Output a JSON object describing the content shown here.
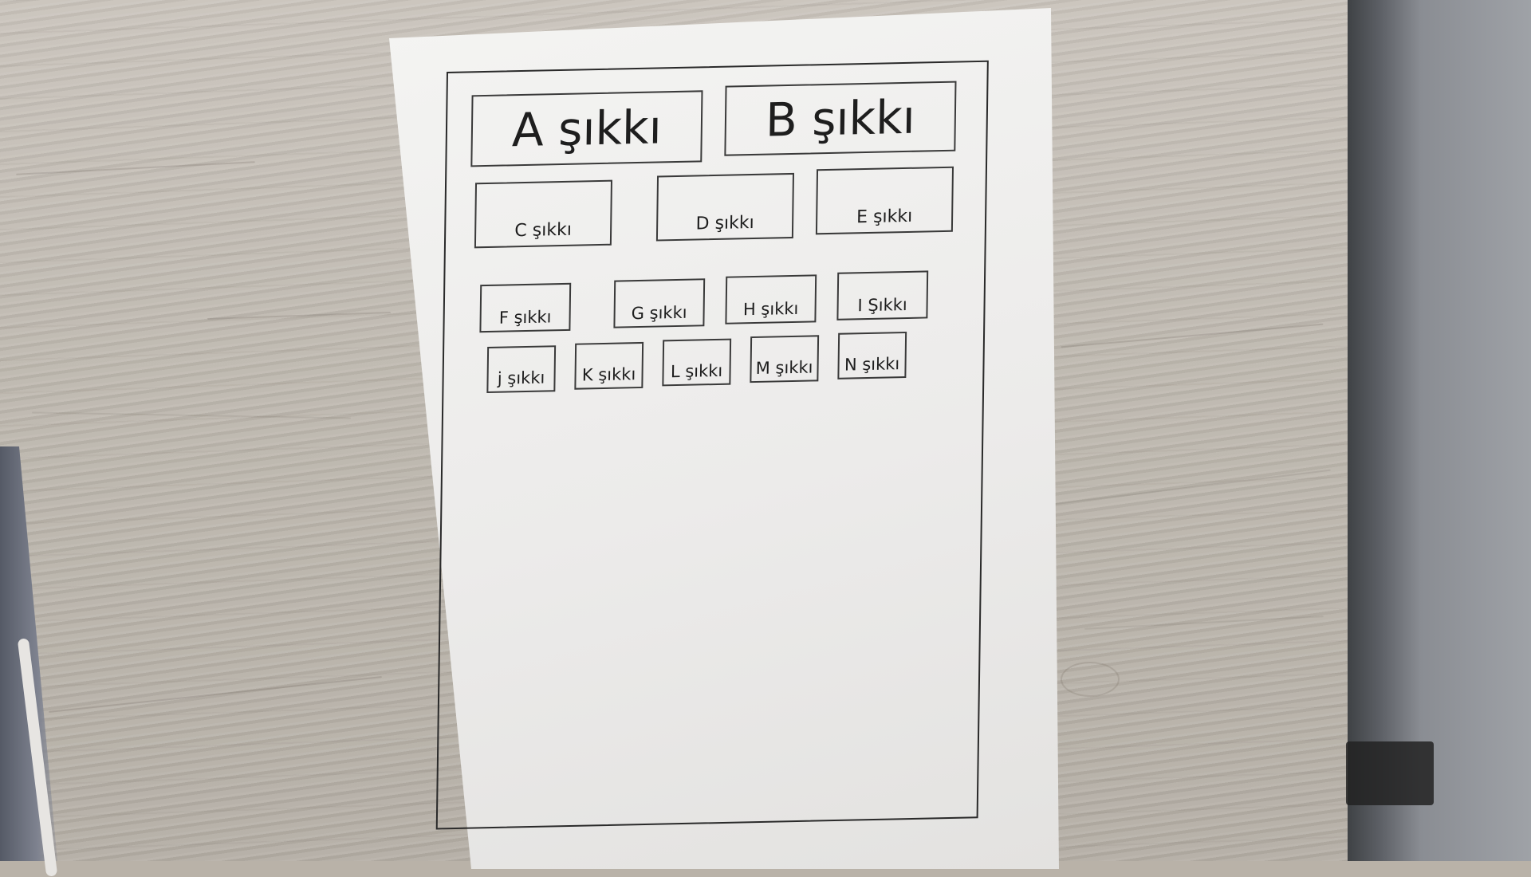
{
  "sheet": {
    "row1": [
      {
        "label": "A şıkkı"
      },
      {
        "label": "B şıkkı"
      }
    ],
    "row2": [
      {
        "label": "C şıkkı"
      },
      {
        "label": "D şıkkı"
      },
      {
        "label": "E şıkkı"
      }
    ],
    "row3": [
      {
        "label": "F şıkkı"
      },
      {
        "label": "G şıkkı"
      },
      {
        "label": "H şıkkı"
      },
      {
        "label": "I Şıkkı"
      }
    ],
    "row4": [
      {
        "label": "j şıkkı"
      },
      {
        "label": "K şıkkı"
      },
      {
        "label": "L şıkkı"
      },
      {
        "label": "M şıkkı"
      },
      {
        "label": "N şıkkı"
      }
    ]
  },
  "colors": {
    "paper": "#efefed",
    "ink": "#1e1e1e",
    "table": "#c2bcb3"
  }
}
